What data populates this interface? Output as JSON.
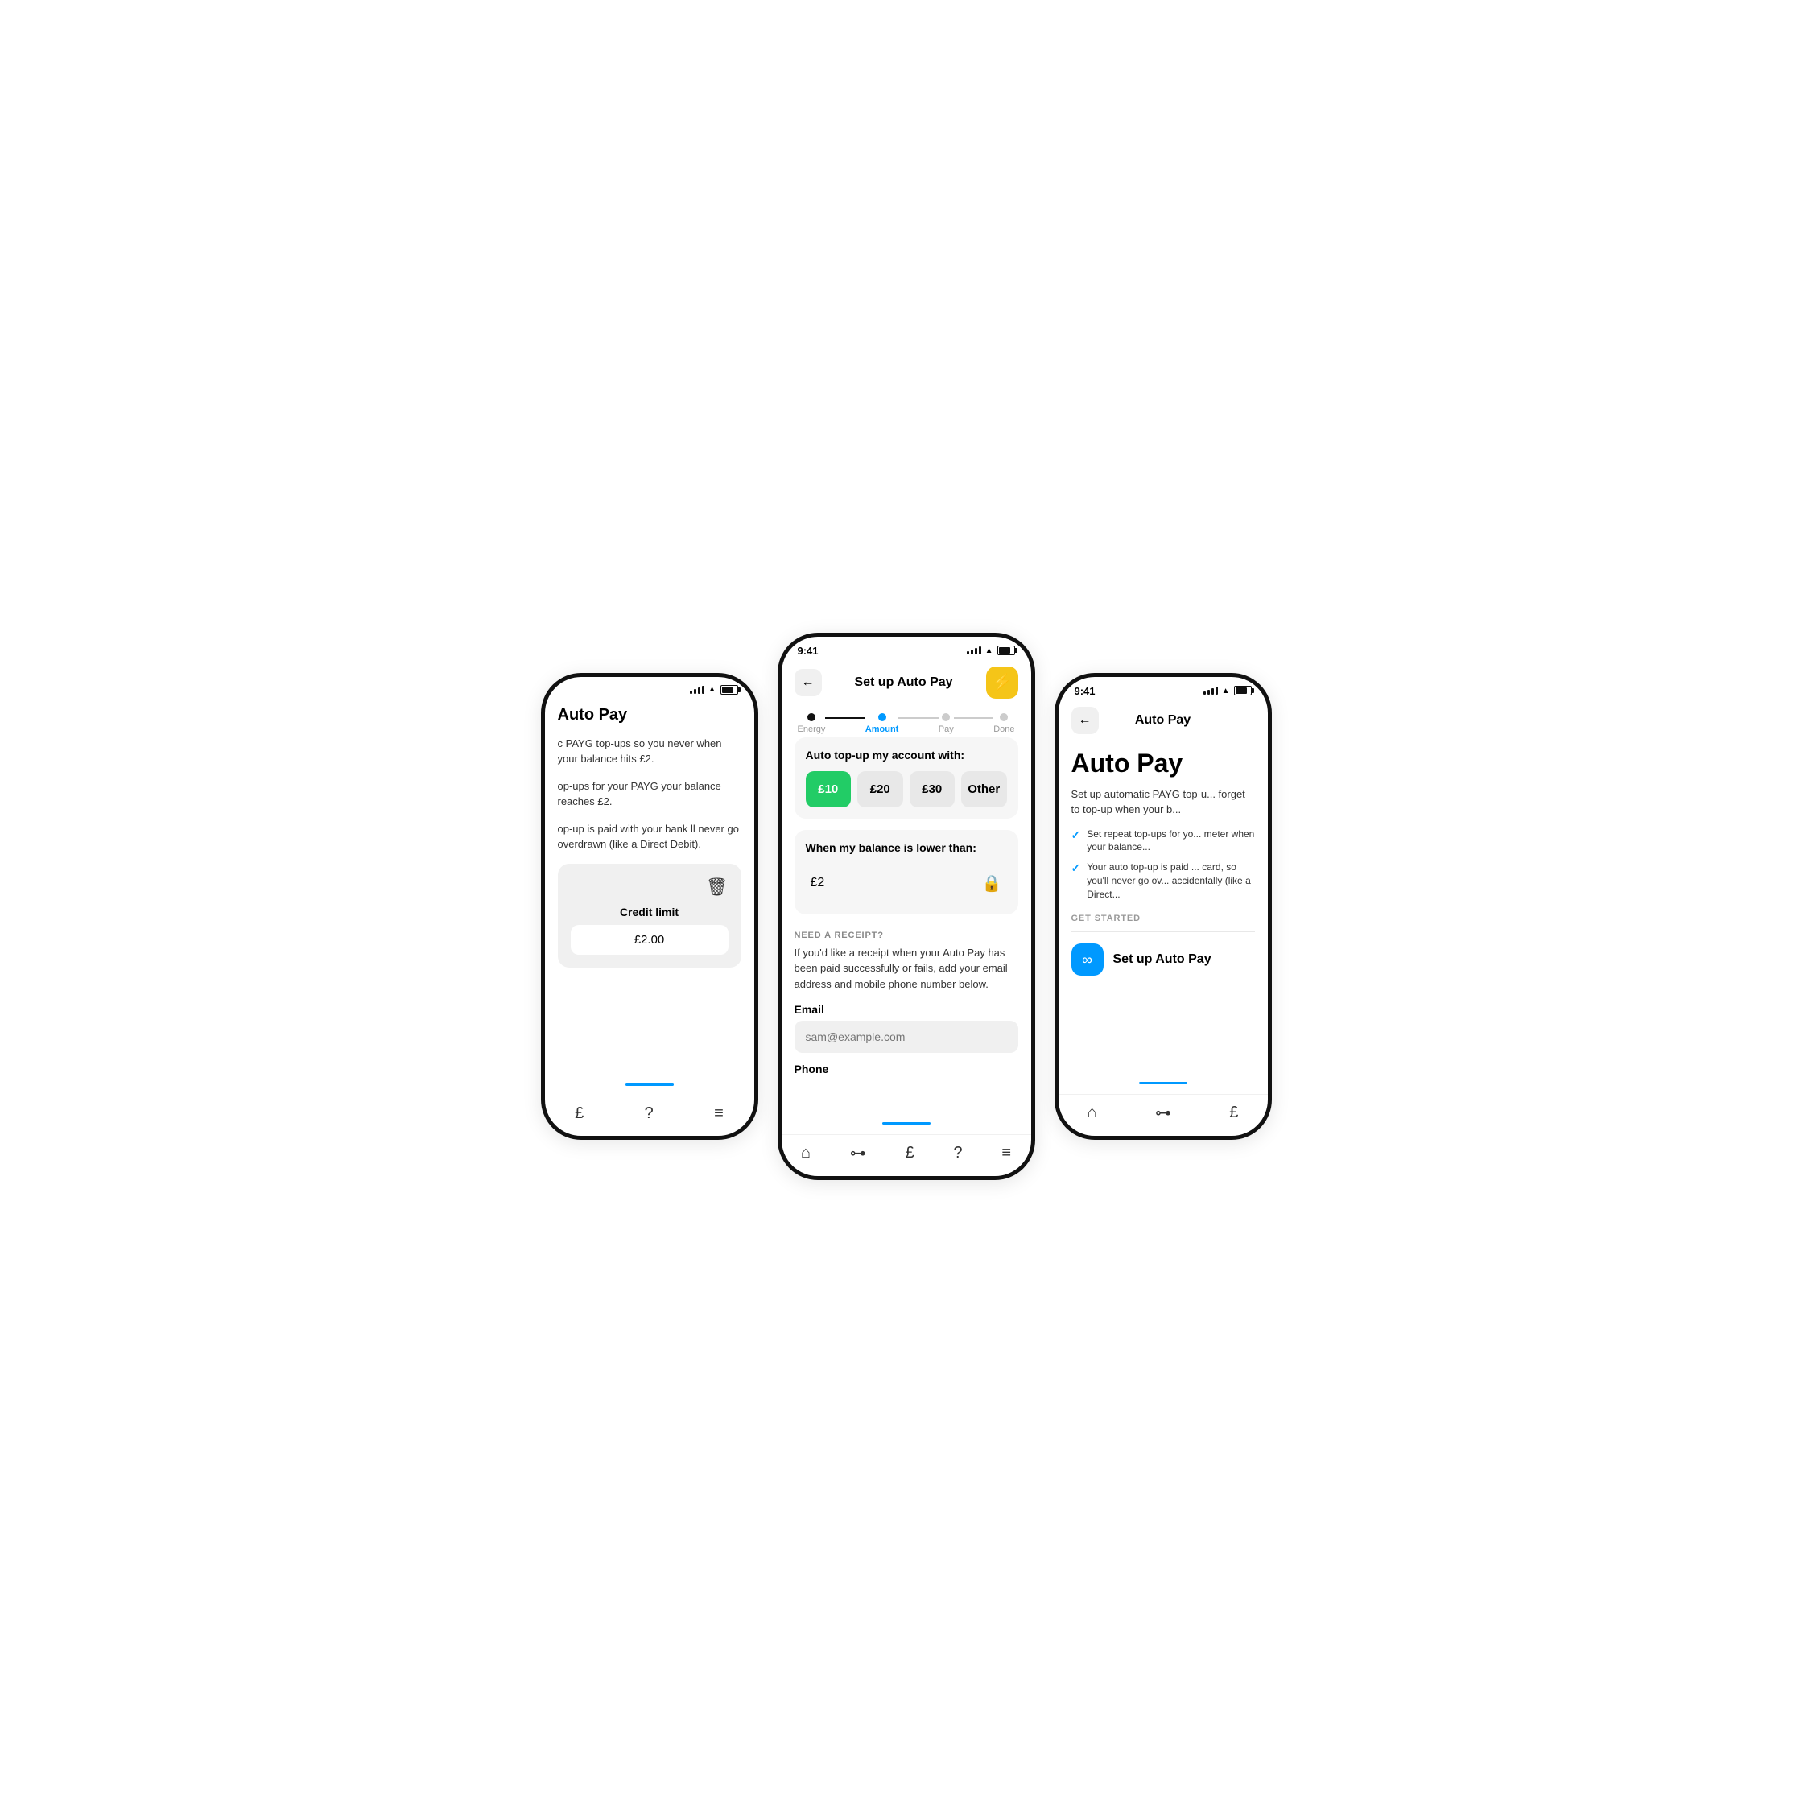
{
  "left_phone": {
    "page_title": "Auto Pay",
    "desc1": "c PAYG top-ups so you never when your balance hits £2.",
    "desc2": "op-ups for your PAYG your balance reaches £2.",
    "desc3": "op-up is paid with your bank ll never go overdrawn (like a Direct Debit).",
    "credit_section": {
      "trash_label": "trash",
      "title": "Credit limit",
      "value": "£2.00"
    },
    "nav_items": [
      "pound",
      "help",
      "menu"
    ]
  },
  "center_phone": {
    "status_time": "9:41",
    "header": {
      "back_label": "←",
      "title": "Set up Auto Pay",
      "lightning_icon": "⚡"
    },
    "progress": {
      "steps": [
        {
          "label": "Energy",
          "state": "done"
        },
        {
          "label": "Amount",
          "state": "active"
        },
        {
          "label": "Pay",
          "state": "inactive"
        },
        {
          "label": "Done",
          "state": "inactive"
        }
      ]
    },
    "top_up_section": {
      "title": "Auto top-up my account with:",
      "options": [
        {
          "label": "£10",
          "selected": true
        },
        {
          "label": "£20",
          "selected": false
        },
        {
          "label": "£30",
          "selected": false
        },
        {
          "label": "Other",
          "selected": false
        }
      ]
    },
    "balance_section": {
      "title": "When my balance is lower than:",
      "value": "£2",
      "lock_icon": "🔒"
    },
    "receipt_section": {
      "label": "NEED A RECEIPT?",
      "description": "If you'd like a receipt when your Auto Pay has been paid successfully or fails, add your email address and mobile phone number below.",
      "email_label": "Email",
      "email_placeholder": "sam@example.com",
      "phone_label": "Phone"
    },
    "nav_items": [
      "home",
      "connect",
      "pound",
      "help",
      "menu"
    ]
  },
  "right_phone": {
    "status_time": "9:41",
    "header": {
      "back_label": "←",
      "title": "Auto Pay"
    },
    "big_title": "Auto Pay",
    "description": "Set up automatic PAYG top-u... forget to top-up when your b...",
    "check_items": [
      "Set repeat top-ups for yo... meter when your balance...",
      "Your auto top-up is paid ... card, so you'll never go ov... accidentally (like a Direct..."
    ],
    "get_started_label": "GET STARTED",
    "setup_button": {
      "icon": "∞",
      "label": "Set up Auto Pay"
    },
    "nav_items": [
      "home",
      "connect",
      "pound"
    ]
  },
  "colors": {
    "accent_blue": "#0099FF",
    "accent_green": "#22CC66",
    "accent_yellow": "#F5C518",
    "bg_light": "#f6f6f6",
    "text_dark": "#111111"
  }
}
